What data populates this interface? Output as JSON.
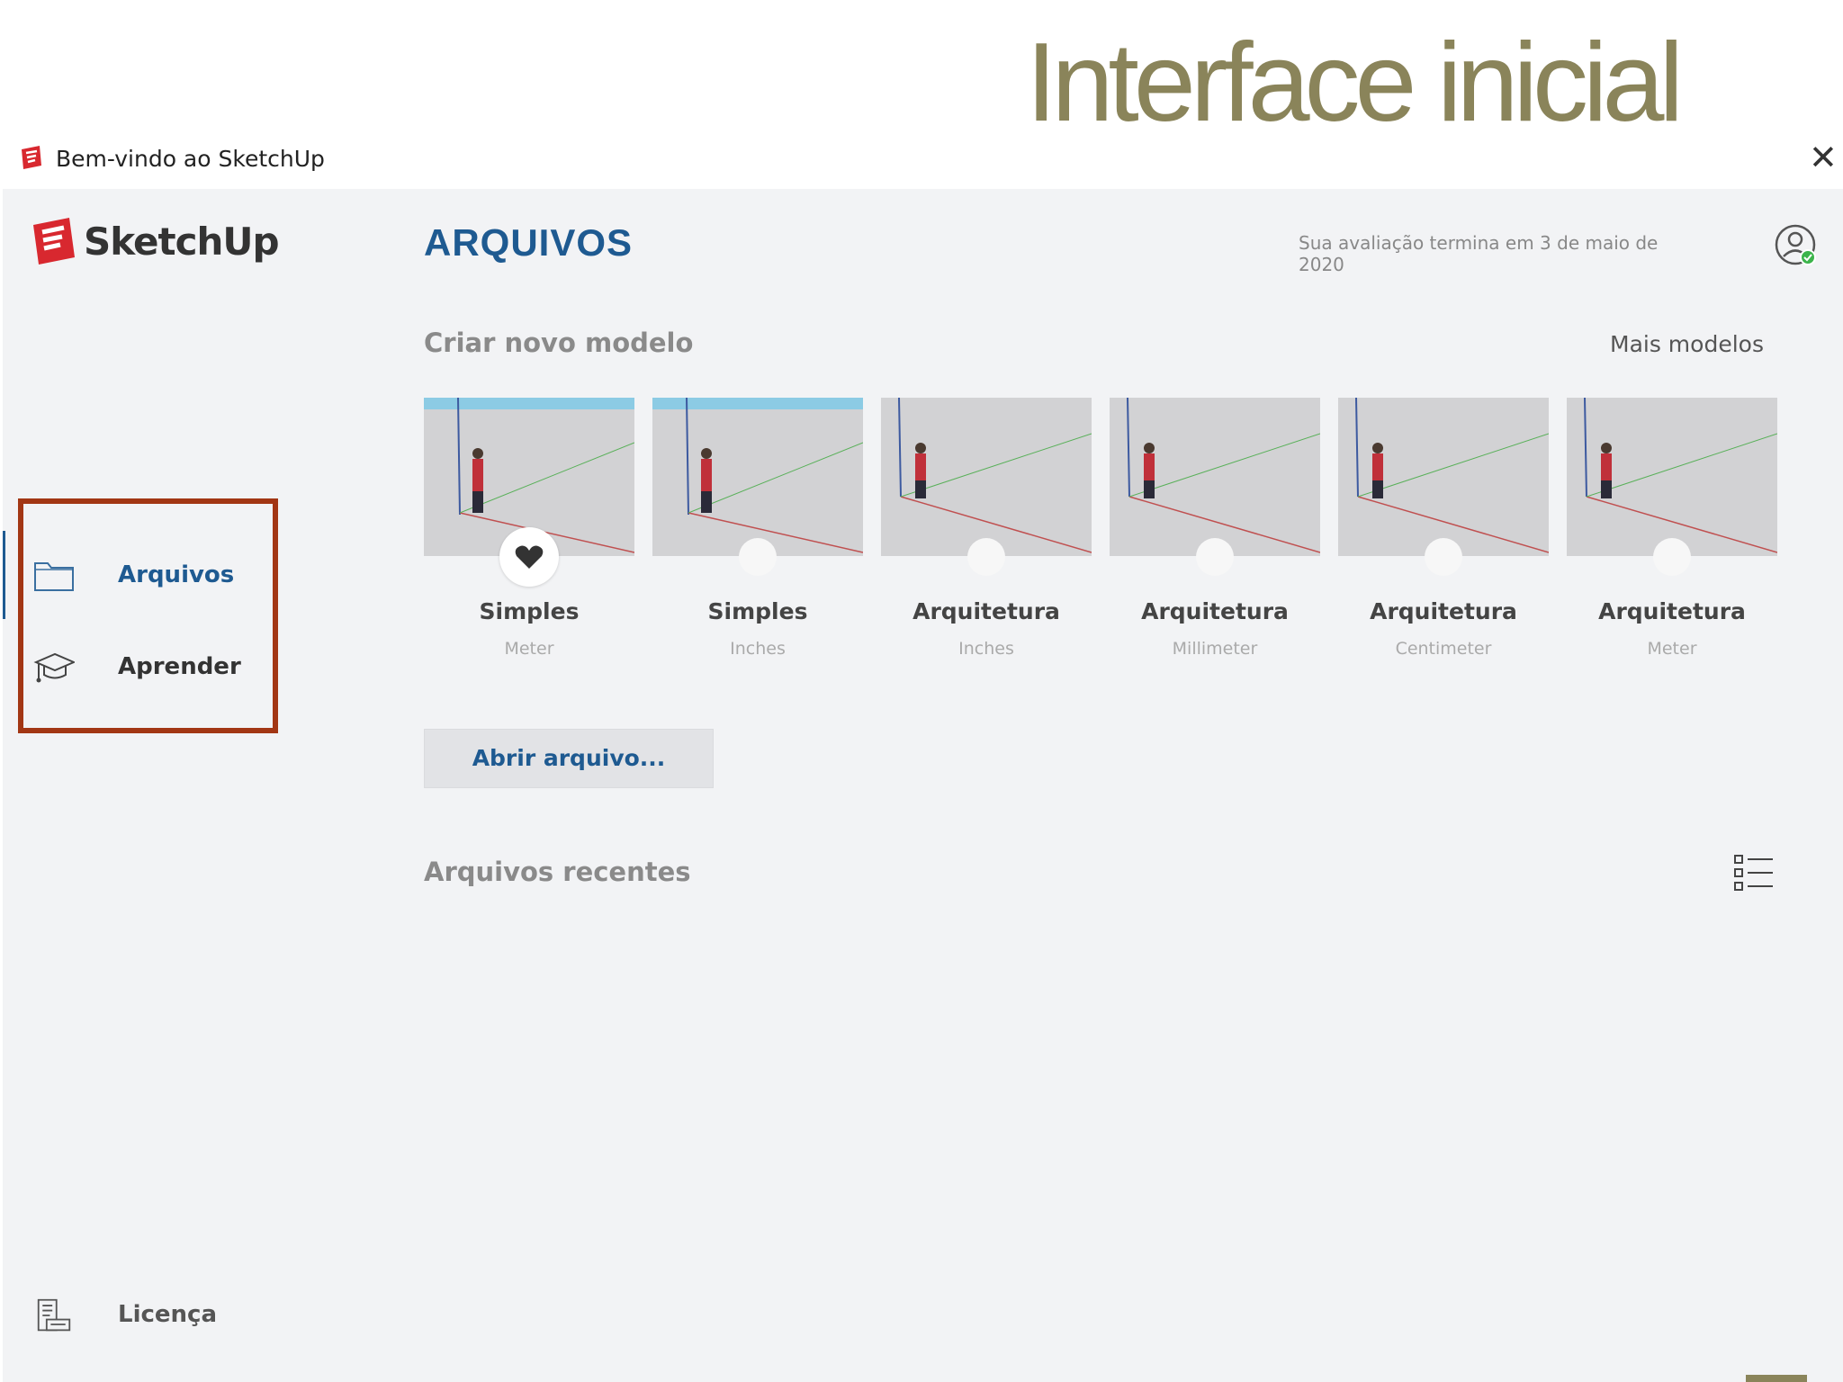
{
  "slide": {
    "title": "Interface inicial"
  },
  "window": {
    "title": "Bem-vindo ao SketchUp",
    "close_glyph": "✕"
  },
  "brand": {
    "name": "SketchUp"
  },
  "sidebar": {
    "items": [
      {
        "label": "Arquivos",
        "icon": "folder-icon",
        "active": true
      },
      {
        "label": "Aprender",
        "icon": "graduation-cap-icon",
        "active": false
      }
    ],
    "footer": {
      "label": "Licença",
      "icon": "license-icon"
    }
  },
  "main": {
    "section_title": "ARQUIVOS",
    "trial_notice": "Sua avaliação termina em 3 de maio de 2020",
    "new_model": {
      "heading": "Criar novo modelo",
      "more_link": "Mais modelos",
      "templates": [
        {
          "name": "Simples",
          "unit": "Meter",
          "favorite": true
        },
        {
          "name": "Simples",
          "unit": "Inches",
          "favorite": false
        },
        {
          "name": "Arquitetura",
          "unit": "Inches",
          "favorite": false
        },
        {
          "name": "Arquitetura",
          "unit": "Millimeter",
          "favorite": false
        },
        {
          "name": "Arquitetura",
          "unit": "Centimeter",
          "favorite": false
        },
        {
          "name": "Arquitetura",
          "unit": "Meter",
          "favorite": false
        }
      ]
    },
    "open_button": "Abrir arquivo...",
    "recent": {
      "heading": "Arquivos recentes"
    }
  },
  "colors": {
    "accent": "#1e5a91",
    "highlight_box": "#a23614",
    "slide_title": "#8a845a",
    "brand_red": "#d8282f"
  }
}
